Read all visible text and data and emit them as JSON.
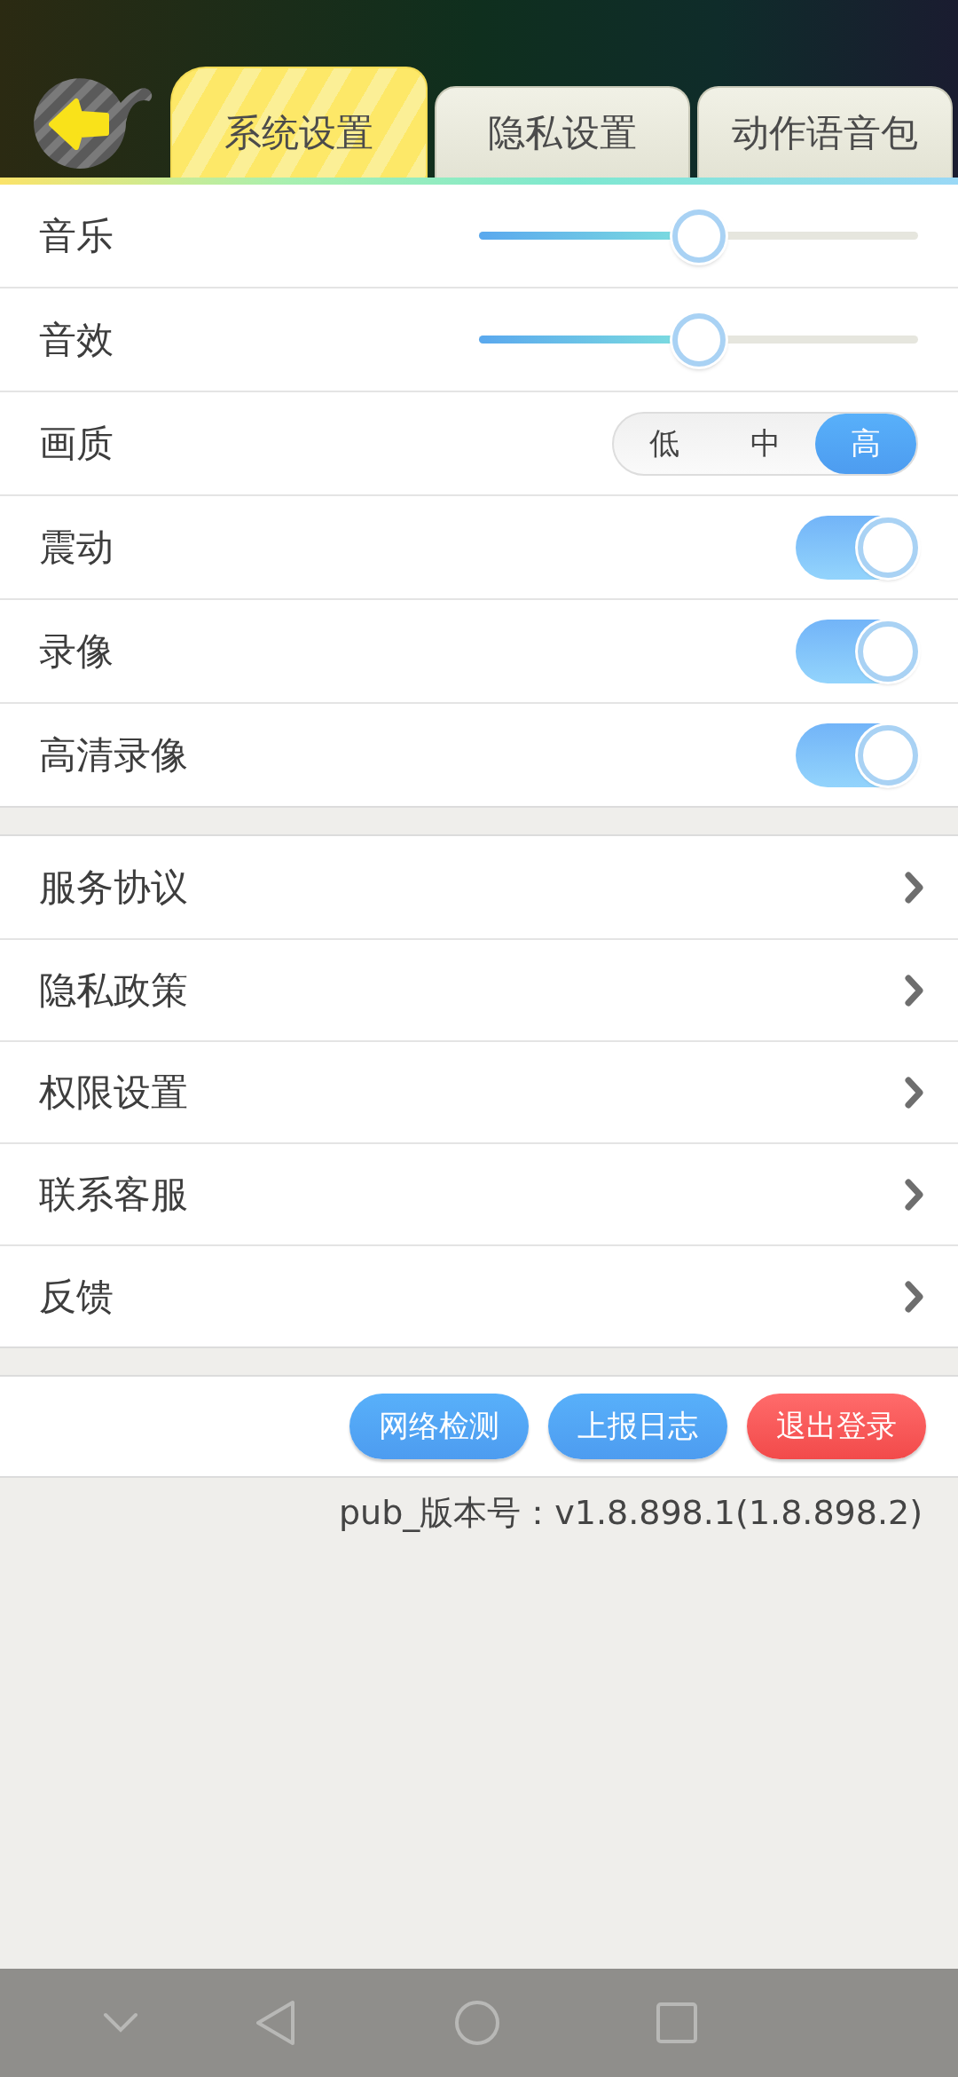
{
  "tabs": [
    {
      "label": "系统设置",
      "selected": true
    },
    {
      "label": "隐私设置",
      "selected": false
    },
    {
      "label": "动作语音包",
      "selected": false
    }
  ],
  "settings": [
    {
      "kind": "slider",
      "label": "音乐",
      "level": 0.5
    },
    {
      "kind": "slider",
      "label": "音效",
      "level": 0.5
    },
    {
      "kind": "segmented",
      "label": "画质",
      "options": [
        {
          "label": "低",
          "selected": false
        },
        {
          "label": "中",
          "selected": false
        },
        {
          "label": "高",
          "selected": true
        }
      ]
    },
    {
      "kind": "toggle",
      "label": "震动",
      "on": true
    },
    {
      "kind": "toggle",
      "label": "录像",
      "on": true
    },
    {
      "kind": "toggle",
      "label": "高清录像",
      "on": true
    }
  ],
  "links": [
    "服务协议",
    "隐私政策",
    "权限设置",
    "联系客服",
    "反馈"
  ],
  "actions": [
    {
      "label": "网络检测",
      "kind": "primary"
    },
    {
      "label": "上报日志",
      "kind": "primary"
    },
    {
      "label": "退出登录",
      "kind": "danger"
    }
  ],
  "version": "pub_版本号：v1.8.898.1(1.8.898.2)"
}
